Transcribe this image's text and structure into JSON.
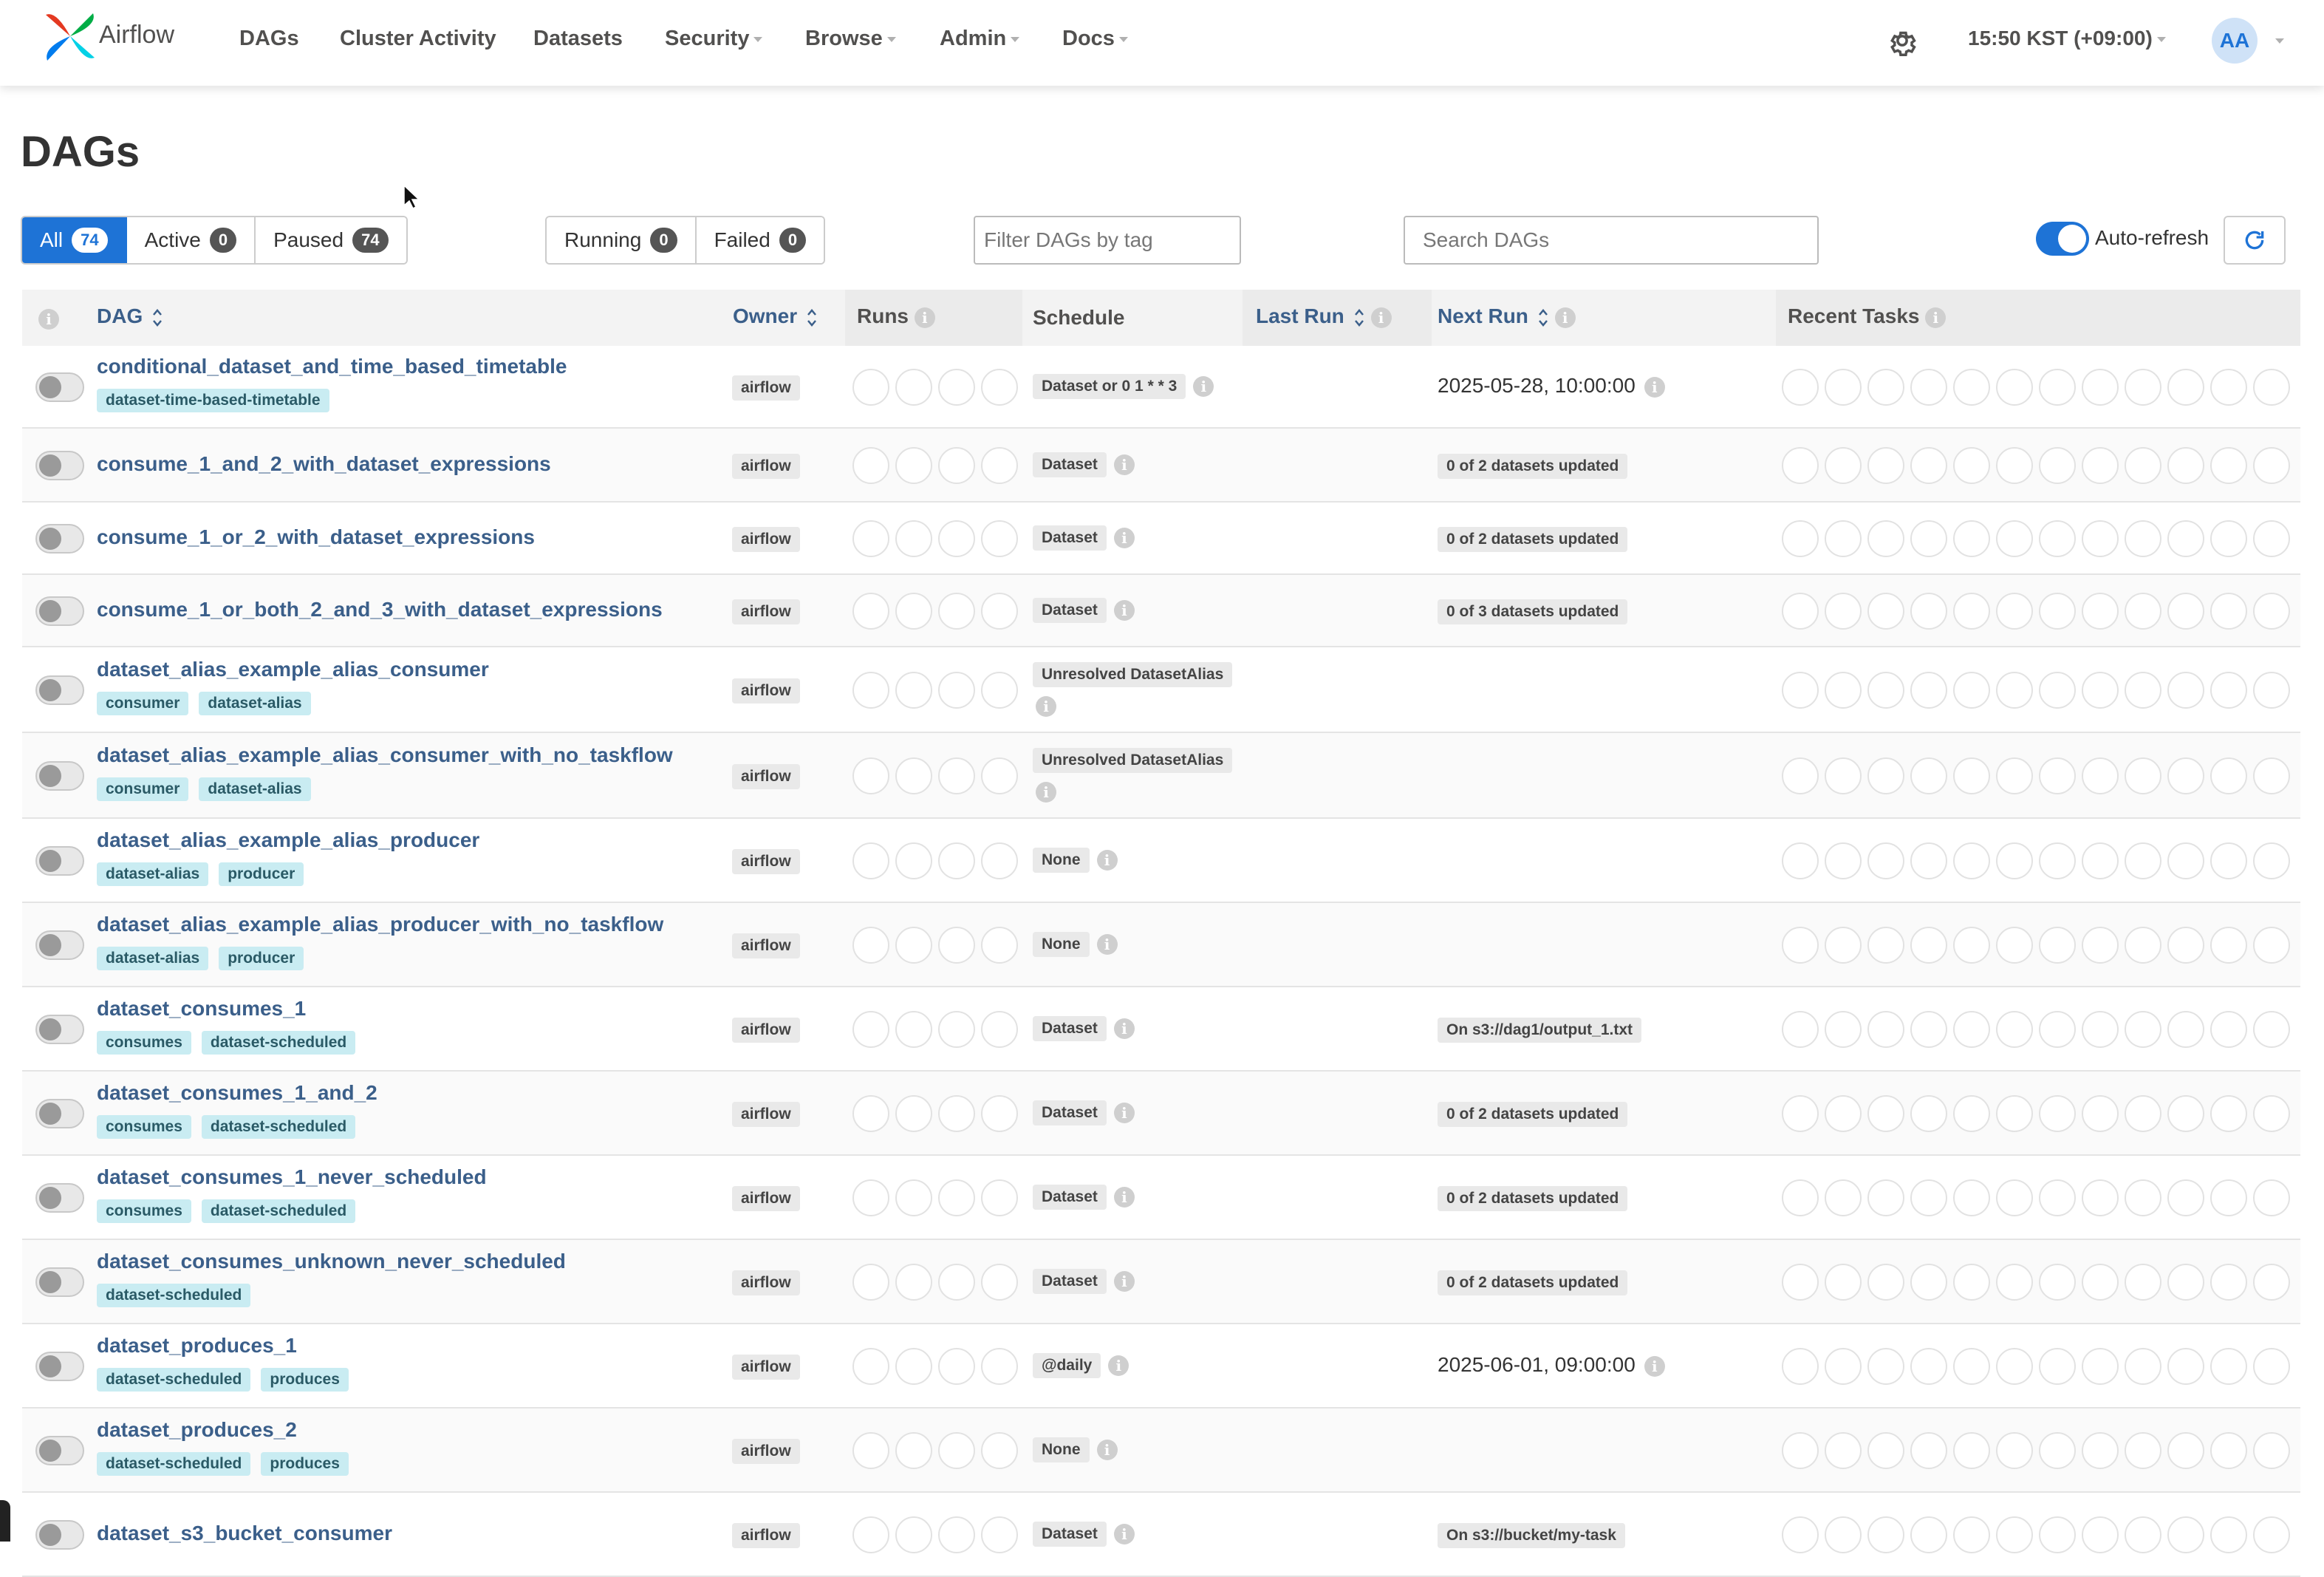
{
  "nav": {
    "brand": "Airflow",
    "items": [
      "DAGs",
      "Cluster Activity",
      "Datasets",
      "Security",
      "Browse",
      "Admin",
      "Docs"
    ],
    "time": "15:50 KST (+09:00)",
    "user_initials": "AA",
    "icons": {
      "settings": "gear-icon",
      "logo": "airflow-pinwheel-logo"
    }
  },
  "page": {
    "title": "DAGs"
  },
  "filters": {
    "status": [
      {
        "label": "All",
        "count": "74"
      },
      {
        "label": "Active",
        "count": "0"
      },
      {
        "label": "Paused",
        "count": "74"
      }
    ],
    "runs": [
      {
        "label": "Running",
        "count": "0"
      },
      {
        "label": "Failed",
        "count": "0"
      }
    ],
    "tag_placeholder": "Filter DAGs by tag",
    "search_placeholder": "Search DAGs",
    "auto_refresh": "Auto-refresh"
  },
  "table": {
    "headers": {
      "dag": "DAG",
      "owner": "Owner",
      "runs": "Runs",
      "schedule": "Schedule",
      "last_run": "Last Run",
      "next_run": "Next Run",
      "recent_tasks": "Recent Tasks"
    },
    "rows": [
      {
        "name": "conditional_dataset_and_time_based_timetable",
        "tags": [
          "dataset-time-based-timetable"
        ],
        "owner": "airflow",
        "schedule": "Dataset or 0 1 * * 3",
        "next_run": "2025-05-28, 10:00:00",
        "next_run_kind": "text"
      },
      {
        "name": "consume_1_and_2_with_dataset_expressions",
        "tags": [],
        "owner": "airflow",
        "schedule": "Dataset",
        "next_run": "0 of 2 datasets updated",
        "next_run_kind": "badge"
      },
      {
        "name": "consume_1_or_2_with_dataset_expressions",
        "tags": [],
        "owner": "airflow",
        "schedule": "Dataset",
        "next_run": "0 of 2 datasets updated",
        "next_run_kind": "badge"
      },
      {
        "name": "consume_1_or_both_2_and_3_with_dataset_expressions",
        "tags": [],
        "owner": "airflow",
        "schedule": "Dataset",
        "next_run": "0 of 3 datasets updated",
        "next_run_kind": "badge"
      },
      {
        "name": "dataset_alias_example_alias_consumer",
        "tags": [
          "consumer",
          "dataset-alias"
        ],
        "owner": "airflow",
        "schedule": "Unresolved DatasetAlias",
        "next_run": "",
        "next_run_kind": "none"
      },
      {
        "name": "dataset_alias_example_alias_consumer_with_no_taskflow",
        "tags": [
          "consumer",
          "dataset-alias"
        ],
        "owner": "airflow",
        "schedule": "Unresolved DatasetAlias",
        "next_run": "",
        "next_run_kind": "none"
      },
      {
        "name": "dataset_alias_example_alias_producer",
        "tags": [
          "dataset-alias",
          "producer"
        ],
        "owner": "airflow",
        "schedule": "None",
        "next_run": "",
        "next_run_kind": "none"
      },
      {
        "name": "dataset_alias_example_alias_producer_with_no_taskflow",
        "tags": [
          "dataset-alias",
          "producer"
        ],
        "owner": "airflow",
        "schedule": "None",
        "next_run": "",
        "next_run_kind": "none"
      },
      {
        "name": "dataset_consumes_1",
        "tags": [
          "consumes",
          "dataset-scheduled"
        ],
        "owner": "airflow",
        "schedule": "Dataset",
        "next_run": "On s3://dag1/output_1.txt",
        "next_run_kind": "badge"
      },
      {
        "name": "dataset_consumes_1_and_2",
        "tags": [
          "consumes",
          "dataset-scheduled"
        ],
        "owner": "airflow",
        "schedule": "Dataset",
        "next_run": "0 of 2 datasets updated",
        "next_run_kind": "badge"
      },
      {
        "name": "dataset_consumes_1_never_scheduled",
        "tags": [
          "consumes",
          "dataset-scheduled"
        ],
        "owner": "airflow",
        "schedule": "Dataset",
        "next_run": "0 of 2 datasets updated",
        "next_run_kind": "badge"
      },
      {
        "name": "dataset_consumes_unknown_never_scheduled",
        "tags": [
          "dataset-scheduled"
        ],
        "owner": "airflow",
        "schedule": "Dataset",
        "next_run": "0 of 2 datasets updated",
        "next_run_kind": "badge"
      },
      {
        "name": "dataset_produces_1",
        "tags": [
          "dataset-scheduled",
          "produces"
        ],
        "owner": "airflow",
        "schedule": "@daily",
        "next_run": "2025-06-01, 09:00:00",
        "next_run_kind": "text"
      },
      {
        "name": "dataset_produces_2",
        "tags": [
          "dataset-scheduled",
          "produces"
        ],
        "owner": "airflow",
        "schedule": "None",
        "next_run": "",
        "next_run_kind": "none"
      },
      {
        "name": "dataset_s3_bucket_consumer",
        "tags": [],
        "owner": "airflow",
        "schedule": "Dataset",
        "next_run": "On s3://bucket/my-task",
        "next_run_kind": "badge"
      }
    ]
  },
  "colors": {
    "primary": "#1e73d6",
    "link": "#3b5f8a",
    "tag_bg": "#c9ecf2"
  }
}
